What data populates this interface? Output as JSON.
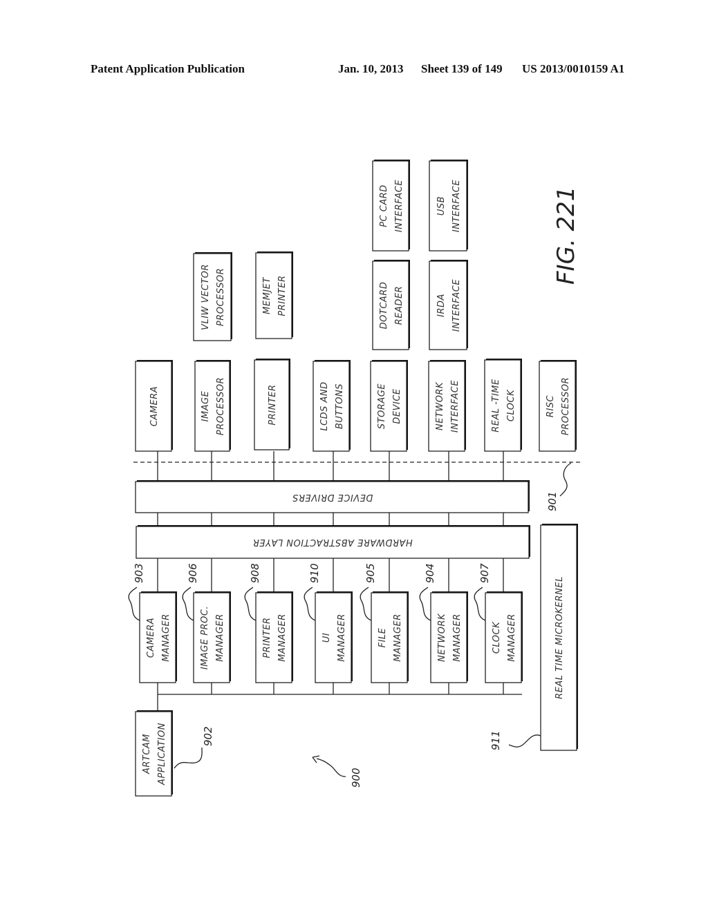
{
  "header": {
    "publication": "Patent Application Publication",
    "date": "Jan. 10, 2013",
    "sheet": "Sheet 139 of 149",
    "number": "US 2013/0010159 A1"
  },
  "figure": {
    "label": "FIG. 221",
    "ref_overall": "900"
  },
  "top_extra": [
    {
      "line1": "VLIW VECTOR",
      "line2": "PROCESSOR"
    },
    {
      "line1": "MEMJET",
      "line2": "PRINTER"
    },
    {
      "line1": "DOTCARD",
      "line2": "READER"
    },
    {
      "line1": "IRDA",
      "line2": "INTERFACE"
    },
    {
      "line1": "PC CARD",
      "line2": "INTERFACE"
    },
    {
      "line1": "USB",
      "line2": "INTERFACE"
    }
  ],
  "hardware": [
    {
      "line1": "CAMERA",
      "line2": ""
    },
    {
      "line1": "IMAGE",
      "line2": "PROCESSOR"
    },
    {
      "line1": "PRINTER",
      "line2": ""
    },
    {
      "line1": "LCDS AND",
      "line2": "BUTTONS"
    },
    {
      "line1": "STORAGE",
      "line2": "DEVICE"
    },
    {
      "line1": "NETWORK",
      "line2": "INTERFACE"
    },
    {
      "line1": "REAL -TIME",
      "line2": "CLOCK"
    },
    {
      "line1": "RISC",
      "line2": "PROCESSOR"
    }
  ],
  "layers": {
    "device_drivers": "DEVICE DRIVERS",
    "hal": "HARDWARE ABSTRACTION LAYER",
    "boundary_ref": "901"
  },
  "managers": [
    {
      "line1": "CAMERA",
      "line2": "MANAGER",
      "ref": "903"
    },
    {
      "line1": "IMAGE PROC.",
      "line2": "MANAGER",
      "ref": "906"
    },
    {
      "line1": "PRINTER",
      "line2": "MANAGER",
      "ref": "908"
    },
    {
      "line1": "UI",
      "line2": "MANAGER",
      "ref": "910"
    },
    {
      "line1": "FILE",
      "line2": "MANAGER",
      "ref": "905"
    },
    {
      "line1": "NETWORK",
      "line2": "MANAGER",
      "ref": "904"
    },
    {
      "line1": "CLOCK",
      "line2": "MANAGER",
      "ref": "907"
    }
  ],
  "application": {
    "line1": "ARTCAM",
    "line2": "APPLICATION",
    "ref": "902"
  },
  "microkernel": {
    "label": "REAL TIME MICROKERNEL",
    "ref": "911"
  }
}
